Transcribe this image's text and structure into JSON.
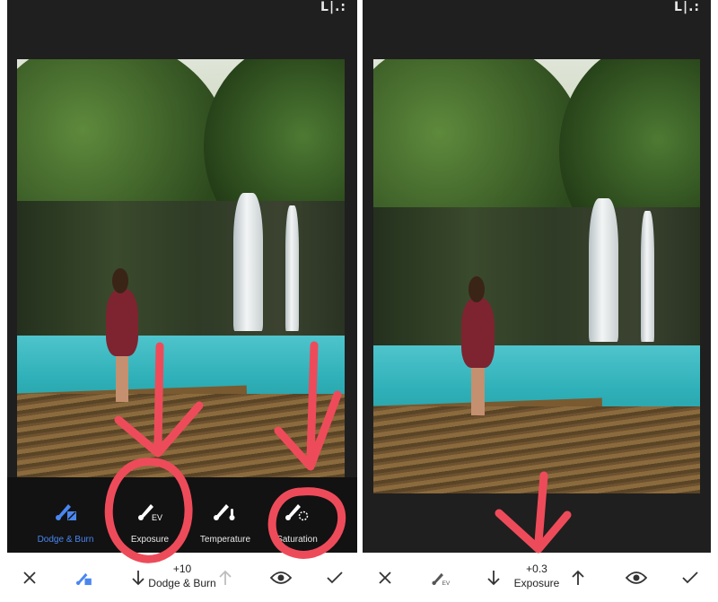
{
  "left_panel": {
    "top_icon": "L|.:",
    "tools": [
      {
        "label": "Dodge & Burn",
        "icon": "brush-square-icon",
        "active": true
      },
      {
        "label": "Exposure",
        "icon": "brush-ev-icon",
        "active": false
      },
      {
        "label": "Temperature",
        "icon": "brush-thermometer-icon",
        "active": false
      },
      {
        "label": "Saturation",
        "icon": "brush-saturation-icon",
        "active": false
      }
    ],
    "bottom": {
      "cancel_icon": "close-icon",
      "brush_icon": "brush-square-icon",
      "value": "+10",
      "value_label": "Dodge & Burn",
      "eye_icon": "eye-icon",
      "confirm_icon": "check-icon"
    }
  },
  "right_panel": {
    "top_icon": "L|.:",
    "bottom": {
      "cancel_icon": "close-icon",
      "brush_icon": "brush-ev-icon",
      "value": "+0.3",
      "value_label": "Exposure",
      "eye_icon": "eye-icon",
      "confirm_icon": "check-icon"
    }
  },
  "colors": {
    "accent": "#4a86f0",
    "annotation": "#ee4b5a",
    "toolbar_bg": "#121212",
    "panel_bg": "#1f1f1f"
  }
}
